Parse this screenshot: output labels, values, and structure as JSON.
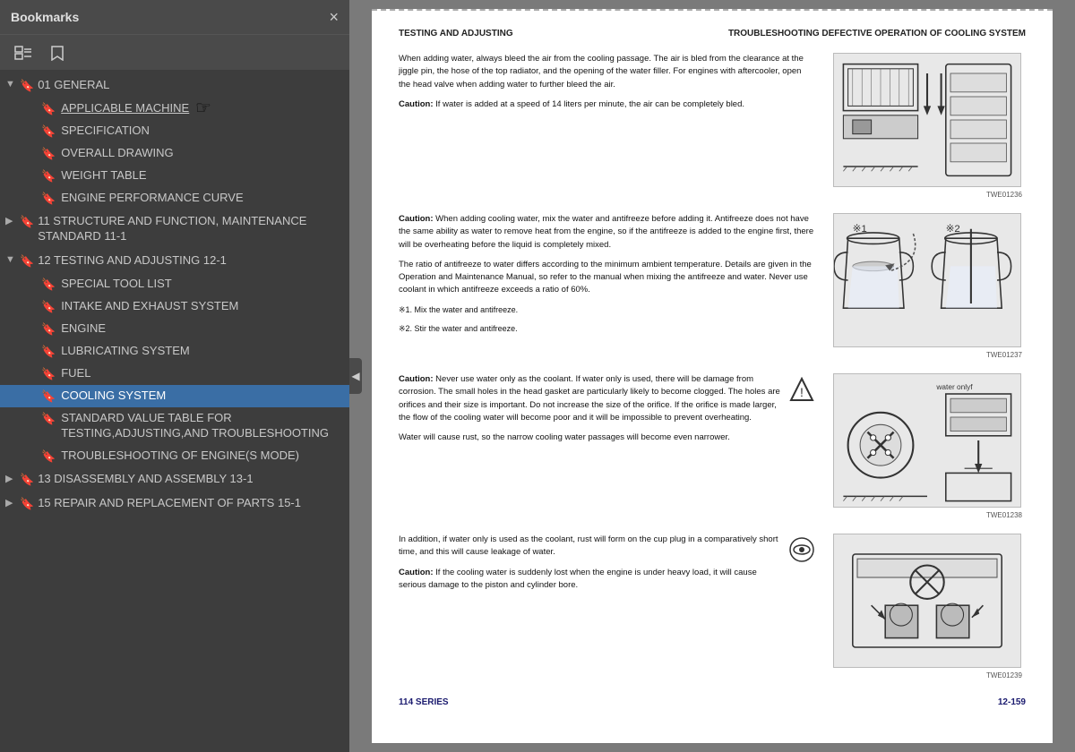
{
  "sidebar": {
    "title": "Bookmarks",
    "close_label": "×",
    "toolbar": {
      "expand_icon": "⊞",
      "bookmark_icon": "🔖"
    },
    "sections": [
      {
        "id": "01-general",
        "label": "01 GENERAL",
        "expanded": true,
        "level": 0,
        "items": [
          {
            "id": "applicable-machine",
            "label": "APPLICABLE MACHINE",
            "underline": true
          },
          {
            "id": "specification",
            "label": "SPECIFICATION",
            "underline": false
          },
          {
            "id": "overall-drawing",
            "label": "OVERALL DRAWING",
            "underline": false
          },
          {
            "id": "weight-table",
            "label": "WEIGHT TABLE",
            "underline": false
          },
          {
            "id": "engine-performance-curve",
            "label": "ENGINE PERFORMANCE CURVE",
            "underline": false
          }
        ]
      },
      {
        "id": "11-structure",
        "label": "11 STRUCTURE AND FUNCTION, MAINTENANCE STANDARD 11-1",
        "expanded": false,
        "level": 0,
        "items": []
      },
      {
        "id": "12-testing",
        "label": "12 TESTING AND ADJUSTING 12-1",
        "expanded": true,
        "level": 0,
        "items": [
          {
            "id": "special-tool-list",
            "label": "SPECIAL TOOL LIST",
            "underline": false
          },
          {
            "id": "intake-exhaust",
            "label": "INTAKE AND EXHAUST SYSTEM",
            "underline": false
          },
          {
            "id": "engine",
            "label": "ENGINE",
            "underline": false
          },
          {
            "id": "lubricating-system",
            "label": "LUBRICATING SYSTEM",
            "underline": false
          },
          {
            "id": "fuel",
            "label": "FUEL",
            "underline": false
          },
          {
            "id": "cooling-system",
            "label": "COOLING SYSTEM",
            "active": true,
            "underline": false
          },
          {
            "id": "standard-value-table",
            "label": "STANDARD VALUE TABLE FOR TESTING,ADJUSTING,AND TROUBLESHOOTING",
            "underline": false
          },
          {
            "id": "troubleshooting-engine",
            "label": "TROUBLESHOOTING OF ENGINE(S MODE)",
            "underline": false
          }
        ]
      },
      {
        "id": "13-disassembly",
        "label": "13 DISASSEMBLY AND ASSEMBLY 13-1",
        "expanded": false,
        "level": 0,
        "items": []
      },
      {
        "id": "15-repair",
        "label": "15 REPAIR AND REPLACEMENT OF PARTS 15-1",
        "expanded": false,
        "level": 0,
        "items": []
      }
    ]
  },
  "document": {
    "header": {
      "left": "TESTING AND ADJUSTING",
      "right": "TROUBLESHOOTING DEFECTIVE OPERATION OF COOLING SYSTEM"
    },
    "sections": [
      {
        "text": "When adding water, always bleed the air from the cooling passage. The air is bled from the clearance at the jiggle pin, the hose of the top radiator, and the opening of the water filler. For engines with aftercooler, open the head valve when adding water to further bleed the air.",
        "caution": "Caution:",
        "caution_text": "If water is added at a speed of 14 liters per minute, the air can be completely bled.",
        "image_label": "TWE01236"
      },
      {
        "text": "",
        "caution": "Caution:",
        "caution_text": "When adding cooling water, mix the water and antifreeze before adding it. Antifreeze does not have the same ability as water to remove heat from the engine, so if the antifreeze is added to the engine first, there will be overheating before the liquid is completely mixed.",
        "extra_text": "The ratio of antifreeze to water differs according to the minimum ambient temperature. Details are given in the Operation and Maintenance Manual, so refer to the manual when mixing the antifreeze and water. Never use coolant in which antifreeze exceeds a ratio of 60%.\n※1. Mix the water and antifreeze.\n※2. Stir the water and antifreeze.",
        "image_label": "TWE01237"
      },
      {
        "text": "",
        "caution": "Caution:",
        "caution_text": "Never use water only as the coolant. If water only is used, there will be damage from corrosion. The small holes in the head gasket are particularly likely to become clogged. The holes are orifices and their size is important. Do not increase the size of the orifice. If the orifice is made larger, the flow of the cooling water will become poor and it will be impossible to prevent overheating.",
        "extra_text": "Water will cause rust, so the narrow cooling water passages will become even narrower.",
        "image_label": "TWE01238",
        "has_warning": true
      },
      {
        "text": "In addition, if water only is used as the coolant, rust will form on the cup plug in a comparatively short time, and this will cause leakage of water.",
        "caution": "Caution:",
        "caution_text": "If the cooling water is suddenly lost when the engine is under heavy load, it will cause serious damage to the piston and cylinder bore.",
        "image_label": "TWE01239",
        "has_eye": true
      }
    ],
    "footer": {
      "left": "114 SERIES",
      "right": "12-159"
    }
  }
}
